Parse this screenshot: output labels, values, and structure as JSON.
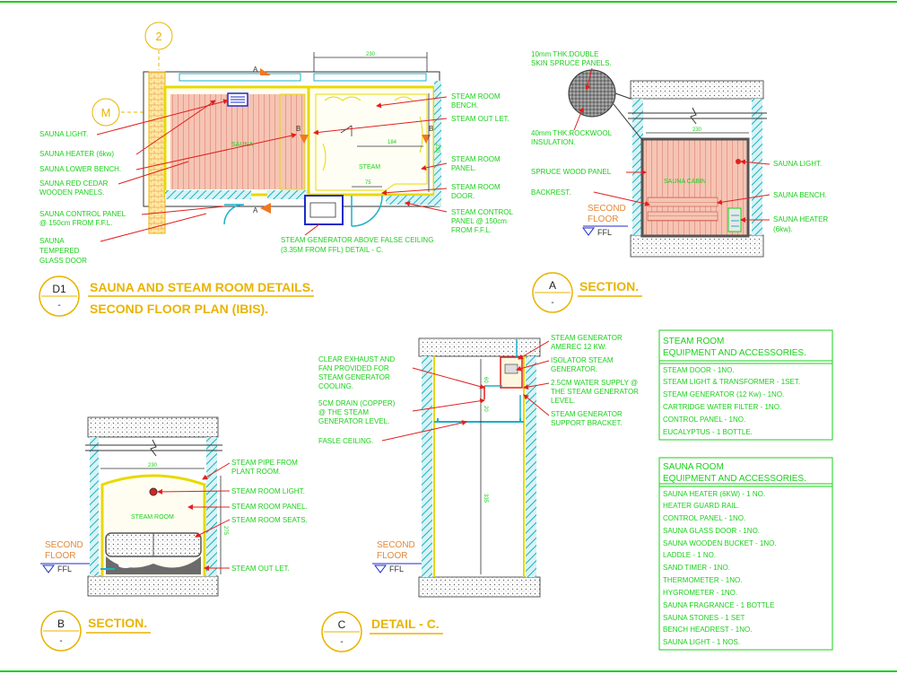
{
  "colors": {
    "background": "#ffffff",
    "annotation": "#19d019",
    "title": "#e9b400",
    "wall": "#e8d900",
    "leader": "#e0201f",
    "cedar": "#f2b8a8",
    "orange": "#f07820",
    "cyan": "#1ab0c8",
    "blue": "#1c2cc8"
  },
  "grid": {
    "col_bubble": "2",
    "row_bubble": "M"
  },
  "plan": {
    "section_marker_a": "A",
    "section_marker_b": "B",
    "dim_top": "230",
    "dim_steam_w": "184",
    "dim_steam_h": "230",
    "dim_door": "75",
    "sauna_room_label": "SAUNA",
    "steam_room_label": "STEAM",
    "left_labels": [
      "SAUNA LIGHT.",
      "SAUNA HEATER (6kw)",
      "SAUNA LOWER BENCH.",
      "SAUNA RED CEDAR",
      "WOODEN PANELS.",
      "SAUNA CONTROL PANEL",
      "@ 150cm FROM F.F.L.",
      "SAUNA",
      "TEMPERED",
      "GLASS DOOR"
    ],
    "right_labels": [
      "STEAM ROOM",
      "BENCH.",
      "STEAM OUT LET.",
      "STEAM ROOM",
      "PANEL.",
      "STEAM ROOM",
      "DOOR.",
      "STEAM CONTROL",
      "PANEL @ 150cm",
      "FROM F.F.L."
    ],
    "bottom_labels": [
      "STEAM GENERATOR ABOVE FALSE CEILING",
      "(3.35M FROM FFL) DETAIL - C."
    ]
  },
  "titles": {
    "d1": {
      "id": "D1",
      "sub": "-",
      "line1": "SAUNA AND STEAM ROOM DETAILS.",
      "line2": "SECOND FLOOR  PLAN (IBIS)."
    },
    "a": {
      "id": "A",
      "sub": "-",
      "text": "SECTION."
    },
    "b": {
      "id": "B",
      "sub": "-",
      "text": "SECTION."
    },
    "c": {
      "id": "C",
      "sub": "-",
      "text": "DETAIL - C."
    }
  },
  "section_a": {
    "dim": "230",
    "room_label": "SAUNA CABIN",
    "floor_line1": "SECOND",
    "floor_line2": "FLOOR",
    "ffl": "FFL",
    "top_labels": [
      "10mm THK.DOUBLE",
      "SKIN SPRUCE PANELS.",
      "40mm THK.ROCKWOOL",
      "INSULATION."
    ],
    "left_labels": [
      "SPRUCE WOOD PANEL",
      "BACKREST."
    ],
    "right_labels": [
      "SAUNA LIGHT.",
      "SAUNA BENCH.",
      "SAUNA HEATER",
      "(6kw)."
    ]
  },
  "section_b": {
    "dim_w": "230",
    "dim_h": "275",
    "room_label": "STEAM ROOM",
    "floor_line1": "SECOND",
    "floor_line2": "FLOOR",
    "ffl": "FFL",
    "right_labels": [
      "STEAM PIPE FROM",
      "PLANT ROOM.",
      "STEAM ROOM LIGHT.",
      "STEAM ROOM PANEL.",
      "STEAM ROOM SEATS.",
      "STEAM OUT LET."
    ]
  },
  "detail_c": {
    "dim_1": "60",
    "dim_2": "20",
    "dim_3": "335",
    "floor_line1": "SECOND",
    "floor_line2": "FLOOR",
    "ffl": "FFL",
    "left_labels": [
      "CLEAR EXHAUST AND",
      "FAN PROVIDED FOR",
      "STEAM GENERATOR",
      "COOLING.",
      "5CM DRAIN (COPPER)",
      "@ THE STEAM",
      "GENERATOR LEVEL.",
      "FASLE CEILING."
    ],
    "right_labels": [
      "STEAM GENERATOR",
      "AMEREC 12 KW.",
      "ISOLATOR STEAM",
      "GENERATOR.",
      "2.5CM WATER SUPPLY @",
      "THE STEAM GENERATOR",
      "LEVEL.",
      "STEAM GENERATOR",
      "SUPPORT BRACKET."
    ]
  },
  "steam_table": {
    "title1": "STEAM ROOM",
    "title2": "EQUIPMENT AND ACCESSORIES.",
    "items": [
      "STEAM DOOR - 1NO.",
      "STEAM LIGHT & TRANSFORMER - 1SET.",
      "STEAM GENERATOR (12 Kw) - 1NO.",
      "CARTRIDGE WATER FILTER - 1NO.",
      "CONTROL PANEL - 1NO.",
      "EUCALYPTUS - 1 BOTTLE."
    ]
  },
  "sauna_table": {
    "title1": "SAUNA ROOM",
    "title2": "EQUIPMENT AND ACCESSORIES.",
    "items": [
      "SAUNA HEATER (6KW) - 1 NO.",
      "HEATER GUARD RAIL.",
      "CONTROL PANEL - 1NO.",
      "SAUNA GLASS DOOR - 1NO.",
      "SAUNA WOODEN BUCKET - 1NO.",
      "LADDLE - 1 NO.",
      "SAND TIMER - 1NO.",
      "THERMOMETER - 1NO.",
      "HYGROMETER - 1NO.",
      "SAUNA FRAGRANCE - 1 BOTTLE",
      "SAUNA STONES - 1 SET",
      "BENCH HEADREST - 1NO.",
      "SAUNA LIGHT - 1 NOS."
    ]
  }
}
